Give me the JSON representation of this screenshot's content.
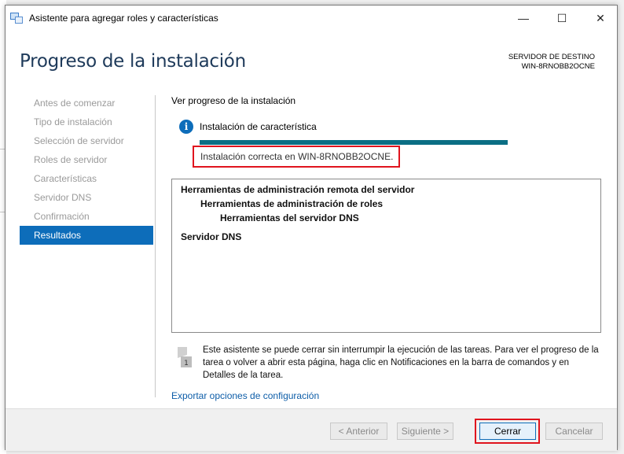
{
  "window": {
    "title": "Asistente para agregar roles y características",
    "controls": {
      "minimize": "—",
      "maximize": "☐",
      "close": "✕"
    }
  },
  "header": {
    "page_title": "Progreso de la instalación",
    "dest_label": "SERVIDOR DE DESTINO",
    "dest_server": "WIN-8RNOBB2OCNE"
  },
  "nav": {
    "items": [
      {
        "label": "Antes de comenzar"
      },
      {
        "label": "Tipo de instalación"
      },
      {
        "label": "Selección de servidor"
      },
      {
        "label": "Roles de servidor"
      },
      {
        "label": "Características"
      },
      {
        "label": "Servidor DNS"
      },
      {
        "label": "Confirmación"
      },
      {
        "label": "Resultados",
        "active": true
      }
    ]
  },
  "main": {
    "progress_label": "Ver progreso de la instalación",
    "install_kind": "Instalación de característica",
    "progress_percent": 100,
    "success_message": "Instalación correcta en WIN-8RNOBB2OCNE.",
    "features": [
      "Herramientas de administración remota del servidor",
      "Herramientas de administración de roles",
      "Herramientas del servidor DNS",
      "Servidor DNS"
    ],
    "note": "Este asistente se puede cerrar sin interrumpir la ejecución de las tareas. Para ver el progreso de la tarea o volver a abrir esta página, haga clic en Notificaciones en la barra de comandos y en Detalles de la tarea.",
    "note_icon_badge": "1",
    "export_link": "Exportar opciones de configuración"
  },
  "footer": {
    "prev": "< Anterior",
    "next": "Siguiente >",
    "close": "Cerrar",
    "cancel": "Cancelar"
  },
  "colors": {
    "accent": "#0d6dba",
    "progress": "#0b6e84",
    "highlight_border": "#e0141e",
    "title": "#1e3a5a"
  }
}
